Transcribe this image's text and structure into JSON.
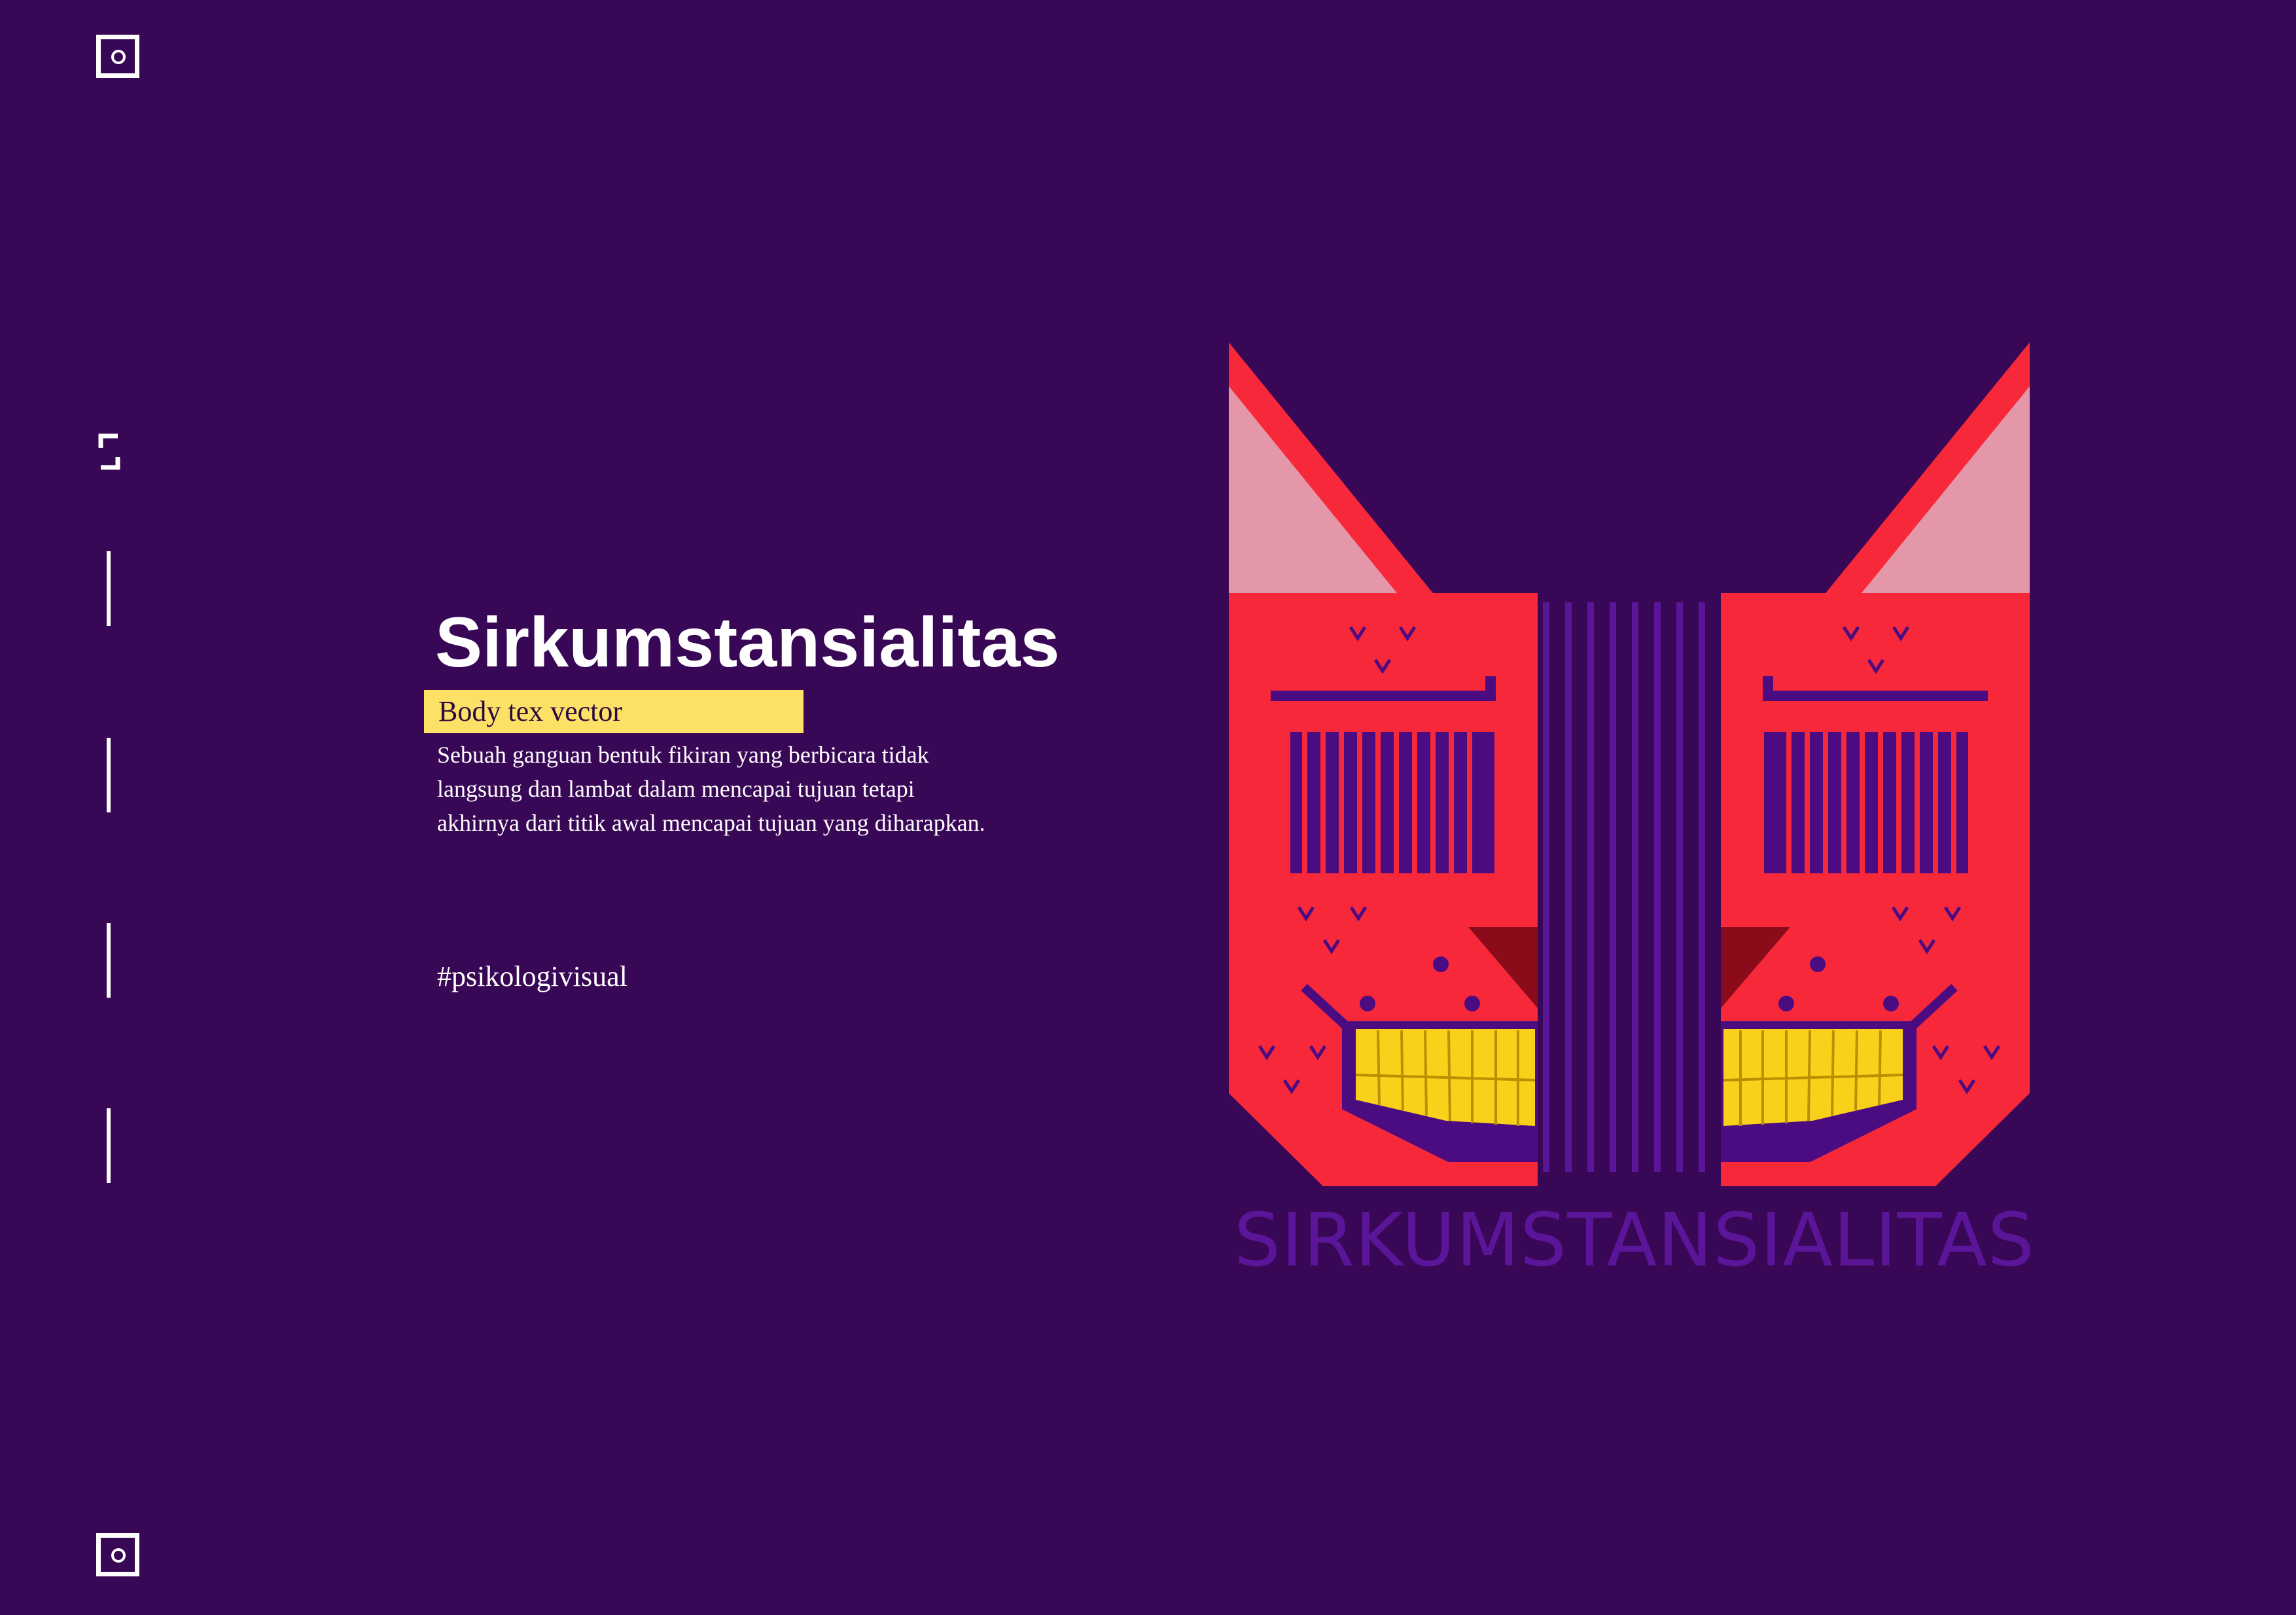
{
  "title": "Sirkumstansialitas",
  "subtitle": "Body tex vector",
  "body": "Sebuah ganguan bentuk fikiran yang berbicara tidak langsung dan lambat dalam mencapai tujuan tetapi akhirnya dari titik awal mencapai tujuan yang diharapkan.",
  "hashtag": "#psikologivisual",
  "artwork": {
    "logo_word": "SIRKUMSTANSIALITAS",
    "subject": "mirrored red cat mask with striped eyes and golden grinning teeth"
  },
  "colors": {
    "background": "#380755",
    "face_red": "#f7283a",
    "ear_pink": "#e497a8",
    "teeth_yellow": "#fad11a",
    "stripe_purple": "#4b0c82",
    "dark_red": "#8a0c1a",
    "badge_yellow": "#fde066",
    "logo_purple": "#5a1599"
  },
  "icons": [
    "focus-square-icon",
    "bracket-icon",
    "divider-line",
    "focus-square-icon"
  ]
}
